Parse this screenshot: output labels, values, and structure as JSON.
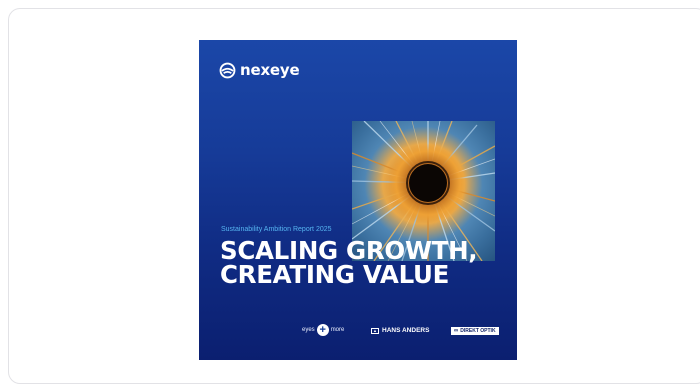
{
  "cover": {
    "brand": "nexeye",
    "subtitle": "Sustainability Ambition Report 2025",
    "headline_line1": "SCALING GROWTH,",
    "headline_line2": "CREATING VALUE",
    "partners": {
      "eyes_more_left": "eyes",
      "eyes_more_right": "more",
      "hans_anders": "HANS ANDERS",
      "direkt_optik": "DIREKT OPTIK"
    },
    "colors": {
      "background_top": "#1b47a8",
      "background_bottom": "#0b1f70",
      "subtitle": "#56b4f0",
      "headline": "#ffffff"
    }
  }
}
